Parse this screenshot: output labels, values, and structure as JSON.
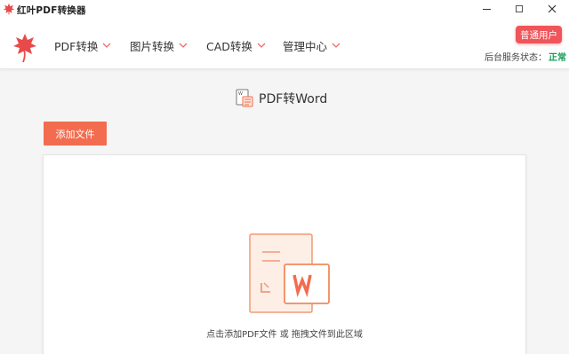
{
  "window": {
    "title": "红叶PDF转换器",
    "minimize_icon": "minimize-icon",
    "maximize_icon": "maximize-icon",
    "close_icon": "close-icon"
  },
  "header": {
    "logo": "maple-leaf-logo",
    "nav": [
      {
        "label": "PDF转换",
        "icon": "chevron-down-icon"
      },
      {
        "label": "图片转换",
        "icon": "chevron-down-icon"
      },
      {
        "label": "CAD转换",
        "icon": "chevron-down-icon"
      },
      {
        "label": "管理中心",
        "icon": "chevron-down-icon"
      }
    ],
    "user_button": "普通用户",
    "service_status_label": "后台服务状态：",
    "service_status_value": "正常"
  },
  "main": {
    "title": "PDF转Word",
    "title_icon": "pdf-to-word-icon",
    "add_file_button": "添加文件",
    "drop_icon": "pdf-to-word-illustration",
    "drop_hint": "点击添加PDF文件 或 拖拽文件到此区域"
  },
  "colors": {
    "accent": "#f36c4f",
    "user_badge": "#f0555a",
    "status_ok": "#18a058",
    "brand": "#e84a4a"
  }
}
